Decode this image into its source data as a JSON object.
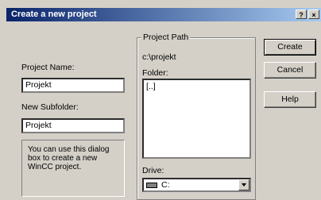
{
  "window": {
    "title": "Create a new project",
    "help_button": "?",
    "close_button": "×"
  },
  "form": {
    "project_name_label": "Project Name:",
    "project_name_value": "Projekt",
    "new_subfolder_label": "New Subfolder:",
    "new_subfolder_value": "Projekt",
    "info_text": "You can use this dialog box to create a new WinCC project."
  },
  "project_path": {
    "group_title": "Project Path",
    "current_path": "c:\\projekt",
    "folder_label": "Folder:",
    "folder_items": [
      "[..]"
    ],
    "drive_label": "Drive:",
    "drive_value": "C:"
  },
  "buttons": {
    "create": "Create",
    "cancel": "Cancel",
    "help": "Help"
  }
}
